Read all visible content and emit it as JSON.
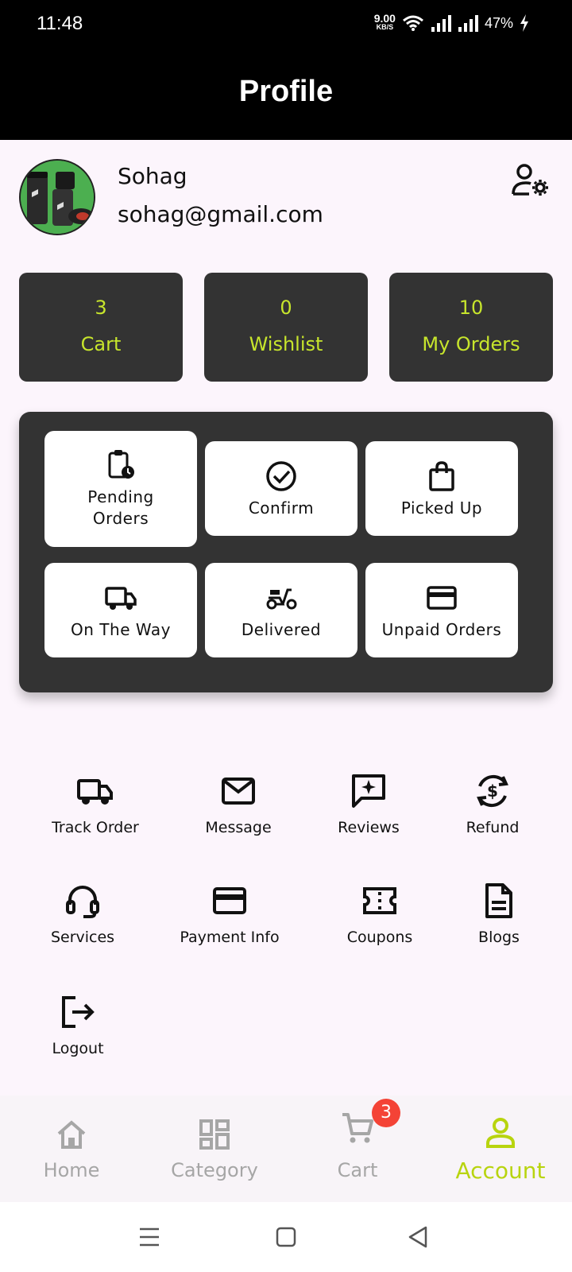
{
  "status_bar": {
    "time": "11:48",
    "net_speed_value": "9.00",
    "net_speed_unit": "KB/S",
    "battery": "47%"
  },
  "app_bar": {
    "title": "Profile"
  },
  "profile": {
    "name": "Sohag",
    "email": "sohag@gmail.com",
    "settings_icon": "user-settings-icon"
  },
  "stats": [
    {
      "value": "3",
      "label": "Cart"
    },
    {
      "value": "0",
      "label": "Wishlist"
    },
    {
      "value": "10",
      "label": "My Orders"
    }
  ],
  "order_status": [
    {
      "label": "Pending\nOrders",
      "icon": "clipboard-clock-icon"
    },
    {
      "label": "Confirm",
      "icon": "check-circle-icon"
    },
    {
      "label": "Picked Up",
      "icon": "shopping-bag-icon"
    },
    {
      "label": "On The Way",
      "icon": "truck-icon"
    },
    {
      "label": "Delivered",
      "icon": "scooter-icon"
    },
    {
      "label": "Unpaid Orders",
      "icon": "credit-card-icon"
    }
  ],
  "actions": [
    {
      "label": "Track Order",
      "icon": "truck-icon"
    },
    {
      "label": "Message",
      "icon": "mail-icon"
    },
    {
      "label": "Reviews",
      "icon": "review-icon"
    },
    {
      "label": "Refund",
      "icon": "refund-icon"
    },
    {
      "label": "Services",
      "icon": "headset-icon"
    },
    {
      "label": "Payment Info",
      "icon": "credit-card-icon"
    },
    {
      "label": "Coupons",
      "icon": "ticket-icon"
    },
    {
      "label": "Blogs",
      "icon": "document-icon"
    },
    {
      "label": "Logout",
      "icon": "logout-icon"
    }
  ],
  "bottom_nav": [
    {
      "label": "Home",
      "icon": "home-icon",
      "active": false
    },
    {
      "label": "Category",
      "icon": "grid-icon",
      "active": false
    },
    {
      "label": "Cart",
      "icon": "cart-icon",
      "active": false,
      "badge": "3"
    },
    {
      "label": "Account",
      "icon": "person-icon",
      "active": true
    }
  ],
  "colors": {
    "accent": "#c7e52c",
    "card_dark": "#333333",
    "background": "#fcf5fc",
    "badge": "#f44336"
  }
}
